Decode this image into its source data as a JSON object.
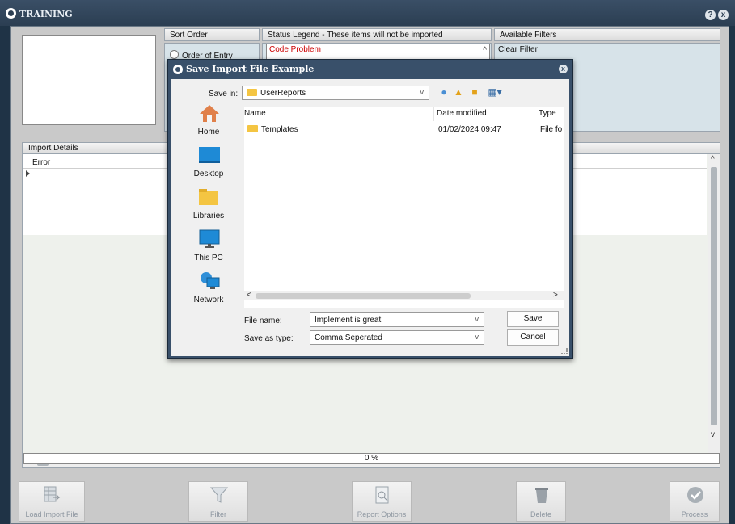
{
  "app": {
    "title": "TRAINING",
    "help_icon": "?",
    "close_icon": "x"
  },
  "sort_order": {
    "header": "Sort Order",
    "option": "Order of Entry"
  },
  "status_legend": {
    "header": "Status Legend - These items will not be imported",
    "items": [
      "Code Problem"
    ]
  },
  "available_filters": {
    "header": "Available Filters",
    "items": [
      "Clear Filter"
    ]
  },
  "import_details": {
    "header": "Import Details",
    "column": "Error"
  },
  "progress": {
    "text": "0 %",
    "value": 0
  },
  "buttons": [
    {
      "label": "Load Import File",
      "icon": "grid-import-icon"
    },
    {
      "label": "Filter",
      "icon": "funnel-icon"
    },
    {
      "label": "Report Options",
      "icon": "report-icon"
    },
    {
      "label": "Delete",
      "icon": "bin-icon"
    },
    {
      "label": "Process",
      "icon": "check-icon"
    }
  ],
  "dialog": {
    "title": "Save Import File Example",
    "save_in_label": "Save in:",
    "save_in_value": "UserReports",
    "places": [
      "Home",
      "Desktop",
      "Libraries",
      "This PC",
      "Network"
    ],
    "columns": [
      "Name",
      "Date modified",
      "Type"
    ],
    "files": [
      {
        "name": "Templates",
        "date": "01/02/2024 09:47",
        "type": "File fo"
      }
    ],
    "file_name_label": "File name:",
    "file_name_value": "Implement is great",
    "save_type_label": "Save as type:",
    "save_type_value": "Comma Seperated",
    "save_button": "Save",
    "cancel_button": "Cancel"
  },
  "colors": {
    "title_bar": "#2b3e52",
    "dialog_frame": "#39506a",
    "legend_red": "#cc0000",
    "filter_bg": "#d7e3e9"
  }
}
